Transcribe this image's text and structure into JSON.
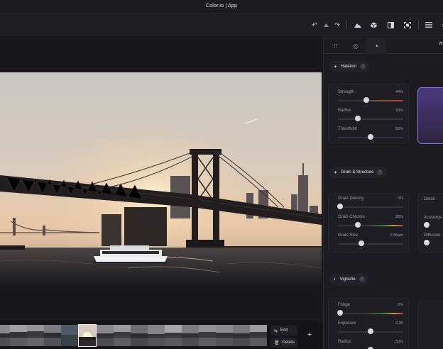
{
  "window": {
    "title": "Color.io | App"
  },
  "toolbar": {
    "icons": [
      "undo-icon",
      "stamp-icon",
      "redo-icon",
      "mountain-icon",
      "cube-icon",
      "compare-icon",
      "fullscreen-icon",
      "menu-icon"
    ]
  },
  "panel": {
    "tabs": [
      {
        "icon": "sliders-icon",
        "active": false
      },
      {
        "icon": "palette-icon",
        "active": false
      },
      {
        "icon": "effects-icon",
        "active": true
      }
    ],
    "tab_right_label": "W",
    "halation": {
      "title": "Halation",
      "help": "?",
      "controls": [
        {
          "label": "Strength",
          "value": "44%",
          "level": 0.44
        },
        {
          "label": "Radius",
          "value": "30%",
          "level": 0.3
        },
        {
          "label": "Threshold",
          "value": "50%",
          "level": 0.5
        }
      ]
    },
    "grain": {
      "title": "Grain & Structure",
      "help": "?",
      "controls": [
        {
          "label": "Grain Density",
          "value": "0%",
          "level": 0.0
        },
        {
          "label": "Grain Chroma",
          "value": "30%",
          "level": 0.3
        },
        {
          "label": "Grain Size",
          "value": "0.36µm",
          "level": 0.36
        }
      ],
      "side_controls": [
        {
          "label": "Detail"
        },
        {
          "label": "Acutance"
        },
        {
          "label": "Diffusion"
        }
      ]
    },
    "vignette": {
      "title": "Vignette",
      "help": "?",
      "controls": [
        {
          "label": "Fringe",
          "value": "0%",
          "level": 0.0
        },
        {
          "label": "Exposure",
          "value": "0.00",
          "level": 0.5
        },
        {
          "label": "Radius",
          "value": "50%",
          "level": 0.5
        }
      ]
    }
  },
  "filmstrip": {
    "edit_label": "Edit",
    "delete_label": "Delete",
    "add_label": "+",
    "selected_index": 4
  },
  "colors": {
    "accent_swatch": "#6a4fc4",
    "background": "#17171b",
    "panel": "#1b1b20"
  }
}
